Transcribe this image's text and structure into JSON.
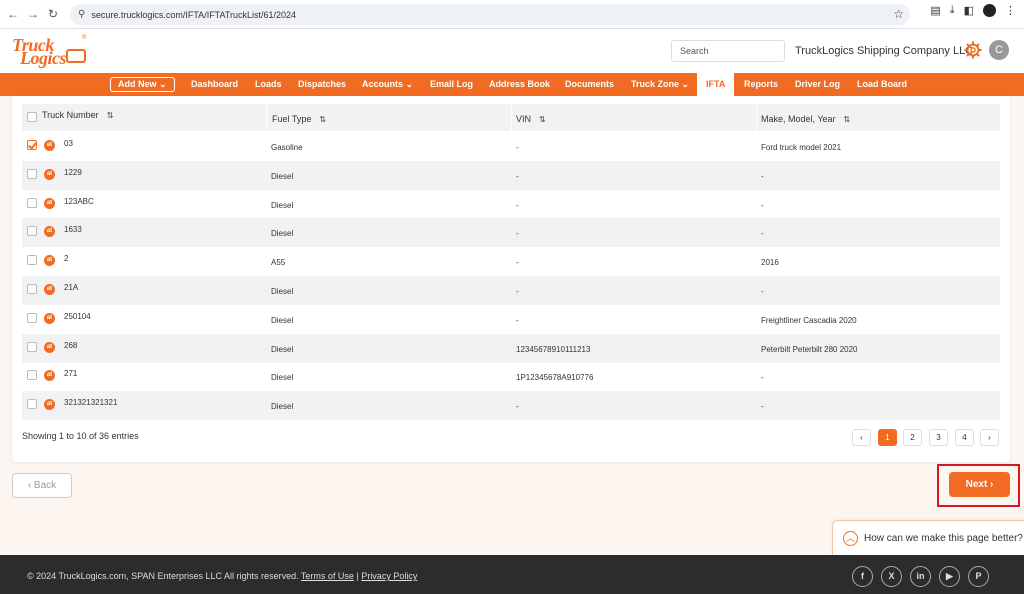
{
  "browser": {
    "url": "secure.trucklogics.com/IFTA/IFTATruckList/61/2024",
    "back_icon": "←",
    "forward_icon": "→",
    "reload_icon": "↻"
  },
  "header": {
    "logo_line1": "Truck",
    "logo_line2": "Logics",
    "logo_reg": "®",
    "search_placeholder": "Search",
    "company_name": "TruckLogics Shipping Company LLC",
    "avatar_letter": "C"
  },
  "nav": {
    "add_new": "Add New ⌄",
    "items": [
      "Dashboard",
      "Loads",
      "Dispatches",
      "Accounts ⌄",
      "Email Log",
      "Address Book",
      "Documents",
      "Truck Zone ⌄",
      "IFTA",
      "Reports",
      "Driver Log",
      "Load Board"
    ]
  },
  "table": {
    "headers": [
      "Truck Number",
      "Fuel Type",
      "VIN",
      "Make, Model, Year"
    ],
    "sort_icon": "⇅",
    "badge": "at",
    "rows": [
      {
        "truck": "03",
        "fuel": "Gasoline",
        "vin": "-",
        "make": "Ford truck model 2021",
        "checked": true
      },
      {
        "truck": "1229",
        "fuel": "Diesel",
        "vin": "-",
        "make": "-",
        "checked": false
      },
      {
        "truck": "123ABC",
        "fuel": "Diesel",
        "vin": "-",
        "make": "-",
        "checked": false
      },
      {
        "truck": "1633",
        "fuel": "Diesel",
        "vin": "-",
        "make": "-",
        "checked": false
      },
      {
        "truck": "2",
        "fuel": "A55",
        "vin": "-",
        "make": "2016",
        "checked": false
      },
      {
        "truck": "21A",
        "fuel": "Diesel",
        "vin": "-",
        "make": "-",
        "checked": false
      },
      {
        "truck": "250104",
        "fuel": "Diesel",
        "vin": "-",
        "make": "Freightliner Cascadia 2020",
        "checked": false
      },
      {
        "truck": "268",
        "fuel": "Diesel",
        "vin": "12345678910111213",
        "make": "Peterbilt Peterbilt 280 2020",
        "checked": false
      },
      {
        "truck": "271",
        "fuel": "Diesel",
        "vin": "1P12345678A910776",
        "make": "-",
        "checked": false
      },
      {
        "truck": "321321321321",
        "fuel": "Diesel",
        "vin": "-",
        "make": "-",
        "checked": false
      }
    ],
    "showing": "Showing 1 to 10 of 36 entries",
    "pages": [
      "‹",
      "1",
      "2",
      "3",
      "4",
      "›"
    ],
    "current_page": "1"
  },
  "actions": {
    "back": "‹ Back",
    "next": "Next ›"
  },
  "feedback": {
    "icon": "︿",
    "text": "How can we make this page better?"
  },
  "footer": {
    "copyright": "© 2024 TruckLogics.com, SPAN Enterprises LLC All rights reserved.",
    "terms": "Terms of Use",
    "separator": "|",
    "privacy": "Privacy Policy",
    "social": [
      "f",
      "X",
      "in",
      "▶",
      "P"
    ]
  },
  "colors": {
    "brand": "#f26b22",
    "footer": "#2c2c2c",
    "highlight": "#d4181f"
  }
}
